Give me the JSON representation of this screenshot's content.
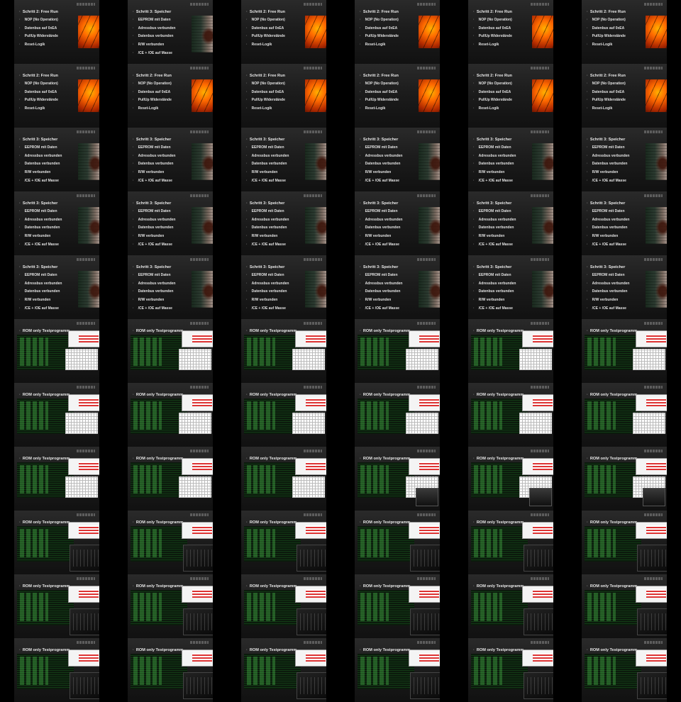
{
  "frames": [
    {
      "type": "free-run",
      "title": "Schritt 2: Free Run",
      "bullets": [
        "NOP (No Operation)",
        "Datenbus auf 0xEA",
        "PullUp Widerstände",
        "Reset-Logik"
      ]
    },
    {
      "type": "speicher",
      "title": "Schritt 3: Speicher",
      "bullets": [
        "EEPROM mit Daten",
        "Adressbus verbunden",
        "Datenbus verbunden",
        "R/W verbunden",
        "/CE + /OE auf Masse"
      ]
    },
    {
      "type": "free-run",
      "title": "Schritt 2: Free Run",
      "bullets": [
        "NOP (No Operation)",
        "Datenbus auf 0xEA",
        "PullUp Widerstände",
        "Reset-Logik"
      ]
    },
    {
      "type": "free-run",
      "title": "Schritt 2: Free Run",
      "bullets": [
        "NOP (No Operation)",
        "Datenbus auf 0xEA",
        "PullUp Widerstände",
        "Reset-Logik"
      ]
    },
    {
      "type": "free-run",
      "title": "Schritt 2: Free Run",
      "bullets": [
        "NOP (No Operation)",
        "Datenbus auf 0xEA",
        "PullUp Widerstände",
        "Reset-Logik"
      ]
    },
    {
      "type": "free-run",
      "title": "Schritt 2: Free Run",
      "bullets": [
        "NOP (No Operation)",
        "Datenbus auf 0xEA",
        "PullUp Widerstände",
        "Reset-Logik"
      ]
    },
    {
      "type": "free-run",
      "title": "Schritt 2: Free Run",
      "bullets": [
        "NOP (No Operation)",
        "Datenbus auf 0xEA",
        "PullUp Widerstände",
        "Reset-Logik"
      ]
    },
    {
      "type": "free-run",
      "title": "Schritt 2: Free Run",
      "bullets": [
        "NOP (No Operation)",
        "Datenbus auf 0xEA",
        "PullUp Widerstände",
        "Reset-Logik"
      ]
    },
    {
      "type": "free-run",
      "title": "Schritt 2: Free Run",
      "bullets": [
        "NOP (No Operation)",
        "Datenbus auf 0xEA",
        "PullUp Widerstände",
        "Reset-Logik"
      ]
    },
    {
      "type": "free-run",
      "title": "Schritt 2: Free Run",
      "bullets": [
        "NOP (No Operation)",
        "Datenbus auf 0xEA",
        "PullUp Widerstände",
        "Reset-Logik"
      ]
    },
    {
      "type": "free-run",
      "title": "Schritt 2: Free Run",
      "bullets": [
        "NOP (No Operation)",
        "Datenbus auf 0xEA",
        "PullUp Widerstände",
        "Reset-Logik"
      ]
    },
    {
      "type": "free-run",
      "title": "Schritt 2: Free Run",
      "bullets": [
        "NOP (No Operation)",
        "Datenbus auf 0xEA",
        "PullUp Widerstände",
        "Reset-Logik"
      ]
    },
    {
      "type": "speicher",
      "title": "Schritt 3: Speicher",
      "bullets": [
        "EEPROM mit Daten",
        "Adressbus verbunden",
        "Datenbus verbunden",
        "R/W verbunden",
        "/CE + /OE auf Masse"
      ]
    },
    {
      "type": "speicher",
      "title": "Schritt 3: Speicher",
      "bullets": [
        "EEPROM mit Daten",
        "Adressbus verbunden",
        "Datenbus verbunden",
        "R/W verbunden",
        "/CE + /OE auf Masse"
      ]
    },
    {
      "type": "speicher",
      "title": "Schritt 3: Speicher",
      "bullets": [
        "EEPROM mit Daten",
        "Adressbus verbunden",
        "Datenbus verbunden",
        "R/W verbunden",
        "/CE + /OE auf Masse"
      ]
    },
    {
      "type": "speicher",
      "title": "Schritt 3: Speicher",
      "bullets": [
        "EEPROM mit Daten",
        "Adressbus verbunden",
        "Datenbus verbunden",
        "R/W verbunden",
        "/CE + /OE auf Masse"
      ]
    },
    {
      "type": "speicher",
      "title": "Schritt 3: Speicher",
      "bullets": [
        "EEPROM mit Daten",
        "Adressbus verbunden",
        "Datenbus verbunden",
        "R/W verbunden",
        "/CE + /OE auf Masse"
      ]
    },
    {
      "type": "speicher",
      "title": "Schritt 3: Speicher",
      "bullets": [
        "EEPROM mit Daten",
        "Adressbus verbunden",
        "Datenbus verbunden",
        "R/W verbunden",
        "/CE + /OE auf Masse"
      ]
    },
    {
      "type": "speicher",
      "title": "Schritt 3: Speicher",
      "bullets": [
        "EEPROM mit Daten",
        "Adressbus verbunden",
        "Datenbus verbunden",
        "R/W verbunden",
        "/CE + /OE auf Masse"
      ]
    },
    {
      "type": "speicher",
      "title": "Schritt 3: Speicher",
      "bullets": [
        "EEPROM mit Daten",
        "Adressbus verbunden",
        "Datenbus verbunden",
        "R/W verbunden",
        "/CE + /OE auf Masse"
      ]
    },
    {
      "type": "speicher",
      "title": "Schritt 3: Speicher",
      "bullets": [
        "EEPROM mit Daten",
        "Adressbus verbunden",
        "Datenbus verbunden",
        "R/W verbunden",
        "/CE + /OE auf Masse"
      ]
    },
    {
      "type": "speicher",
      "title": "Schritt 3: Speicher",
      "bullets": [
        "EEPROM mit Daten",
        "Adressbus verbunden",
        "Datenbus verbunden",
        "R/W verbunden",
        "/CE + /OE auf Masse"
      ]
    },
    {
      "type": "speicher",
      "title": "Schritt 3: Speicher",
      "bullets": [
        "EEPROM mit Daten",
        "Adressbus verbunden",
        "Datenbus verbunden",
        "R/W verbunden",
        "/CE + /OE auf Masse"
      ]
    },
    {
      "type": "speicher",
      "title": "Schritt 3: Speicher",
      "bullets": [
        "EEPROM mit Daten",
        "Adressbus verbunden",
        "Datenbus verbunden",
        "R/W verbunden",
        "/CE + /OE auf Masse"
      ]
    },
    {
      "type": "speicher",
      "title": "Schritt 3: Speicher",
      "bullets": [
        "EEPROM mit Daten",
        "Adressbus verbunden",
        "Datenbus verbunden",
        "R/W verbunden",
        "/CE + /OE auf Masse"
      ]
    },
    {
      "type": "speicher",
      "title": "Schritt 3: Speicher",
      "bullets": [
        "EEPROM mit Daten",
        "Adressbus verbunden",
        "Datenbus verbunden",
        "R/W verbunden",
        "/CE + /OE auf Masse"
      ]
    },
    {
      "type": "speicher",
      "title": "Schritt 3: Speicher",
      "bullets": [
        "EEPROM mit Daten",
        "Adressbus verbunden",
        "Datenbus verbunden",
        "R/W verbunden",
        "/CE + /OE auf Masse"
      ]
    },
    {
      "type": "speicher",
      "title": "Schritt 3: Speicher",
      "bullets": [
        "EEPROM mit Daten",
        "Adressbus verbunden",
        "Datenbus verbunden",
        "R/W verbunden",
        "/CE + /OE auf Masse"
      ]
    },
    {
      "type": "speicher",
      "title": "Schritt 3: Speicher",
      "bullets": [
        "EEPROM mit Daten",
        "Adressbus verbunden",
        "Datenbus verbunden",
        "R/W verbunden",
        "/CE + /OE auf Masse"
      ]
    },
    {
      "type": "speicher",
      "title": "Schritt 3: Speicher",
      "bullets": [
        "EEPROM mit Daten",
        "Adressbus verbunden",
        "Datenbus verbunden",
        "R/W verbunden",
        "/CE + /OE auf Masse"
      ]
    },
    {
      "type": "rom-a",
      "title": "ROM only Testprogramm",
      "bullets": []
    },
    {
      "type": "rom-a",
      "title": "ROM only Testprogramm",
      "bullets": []
    },
    {
      "type": "rom-a",
      "title": "ROM only Testprogramm",
      "bullets": []
    },
    {
      "type": "rom-a",
      "title": "ROM only Testprogramm",
      "bullets": []
    },
    {
      "type": "rom-a",
      "title": "ROM only Testprogramm",
      "bullets": []
    },
    {
      "type": "rom-a",
      "title": "ROM only Testprogramm",
      "bullets": []
    },
    {
      "type": "rom-a",
      "title": "ROM only Testprogramm",
      "bullets": []
    },
    {
      "type": "rom-a",
      "title": "ROM only Testprogramm",
      "bullets": []
    },
    {
      "type": "rom-a",
      "title": "ROM only Testprogramm",
      "bullets": []
    },
    {
      "type": "rom-a",
      "title": "ROM only Testprogramm",
      "bullets": []
    },
    {
      "type": "rom-a",
      "title": "ROM only Testprogramm",
      "bullets": []
    },
    {
      "type": "rom-a",
      "title": "ROM only Testprogramm",
      "bullets": []
    },
    {
      "type": "rom-a",
      "title": "ROM only Testprogramm",
      "bullets": []
    },
    {
      "type": "rom-a",
      "title": "ROM only Testprogramm",
      "bullets": []
    },
    {
      "type": "rom-a",
      "title": "ROM only Testprogramm",
      "bullets": []
    },
    {
      "type": "rom-b",
      "title": "ROM only Testprogramm",
      "bullets": []
    },
    {
      "type": "rom-b",
      "title": "ROM only Testprogramm",
      "bullets": []
    },
    {
      "type": "rom-b",
      "title": "ROM only Testprogramm",
      "bullets": []
    },
    {
      "type": "rom-c",
      "title": "ROM only Testprogramm",
      "bullets": []
    },
    {
      "type": "rom-c",
      "title": "ROM only Testprogramm",
      "bullets": []
    },
    {
      "type": "rom-c",
      "title": "ROM only Testprogramm",
      "bullets": []
    },
    {
      "type": "rom-c",
      "title": "ROM only Testprogramm",
      "bullets": []
    },
    {
      "type": "rom-c",
      "title": "ROM only Testprogramm",
      "bullets": []
    },
    {
      "type": "rom-c",
      "title": "ROM only Testprogramm",
      "bullets": []
    },
    {
      "type": "rom-c",
      "title": "ROM only Testprogramm",
      "bullets": []
    },
    {
      "type": "rom-c",
      "title": "ROM only Testprogramm",
      "bullets": []
    },
    {
      "type": "rom-c",
      "title": "ROM only Testprogramm",
      "bullets": []
    },
    {
      "type": "rom-c",
      "title": "ROM only Testprogramm",
      "bullets": []
    },
    {
      "type": "rom-c",
      "title": "ROM only Testprogramm",
      "bullets": []
    },
    {
      "type": "rom-c",
      "title": "ROM only Testprogramm",
      "bullets": []
    },
    {
      "type": "rom-c",
      "title": "ROM only Testprogramm",
      "bullets": []
    },
    {
      "type": "rom-c",
      "title": "ROM only Testprogramm",
      "bullets": []
    },
    {
      "type": "rom-c",
      "title": "ROM only Testprogramm",
      "bullets": []
    },
    {
      "type": "rom-c",
      "title": "ROM only Testprogramm",
      "bullets": []
    },
    {
      "type": "rom-c",
      "title": "ROM only Testprogramm",
      "bullets": []
    },
    {
      "type": "rom-c",
      "title": "ROM only Testprogramm",
      "bullets": []
    }
  ]
}
